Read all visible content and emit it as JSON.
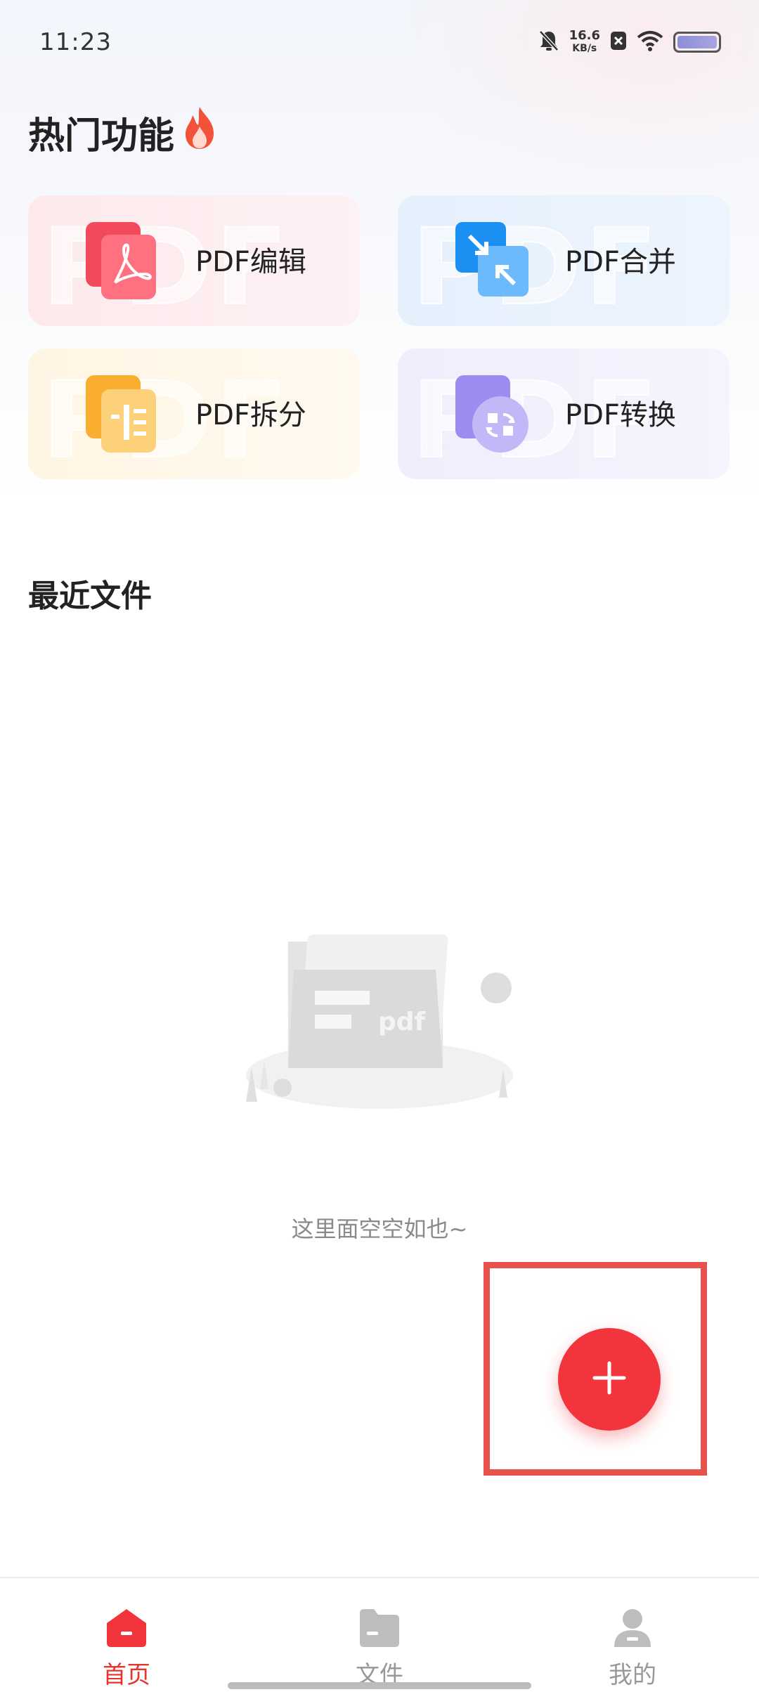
{
  "status_bar": {
    "time": "11:23",
    "net_speed": "16.6",
    "net_unit": "KB/s",
    "icons": [
      "mute-bell-icon",
      "close-box-icon",
      "wifi-icon",
      "battery-icon"
    ]
  },
  "hot_features": {
    "title": "热门功能",
    "title_icon": "fire-icon",
    "cards": [
      {
        "label": "PDF编辑",
        "icon": "pdf-edit-icon",
        "color": "#f2343d"
      },
      {
        "label": "PDF合并",
        "icon": "pdf-merge-icon",
        "color": "#2a9af5"
      },
      {
        "label": "PDF拆分",
        "icon": "pdf-split-icon",
        "color": "#f7a92c"
      },
      {
        "label": "PDF转换",
        "icon": "pdf-convert-icon",
        "color": "#9b8cf0"
      }
    ],
    "card_watermark": "PDF"
  },
  "recent_files": {
    "title": "最近文件",
    "empty_text": "这里面空空如也~",
    "illustration_text": "pdf"
  },
  "fab": {
    "icon": "plus-icon",
    "color": "#f2343d"
  },
  "bottom_nav": {
    "items": [
      {
        "label": "首页",
        "icon": "home-icon",
        "active": true
      },
      {
        "label": "文件",
        "icon": "folder-icon",
        "active": false
      },
      {
        "label": "我的",
        "icon": "profile-icon",
        "active": false
      }
    ],
    "active_color": "#e8332f"
  }
}
